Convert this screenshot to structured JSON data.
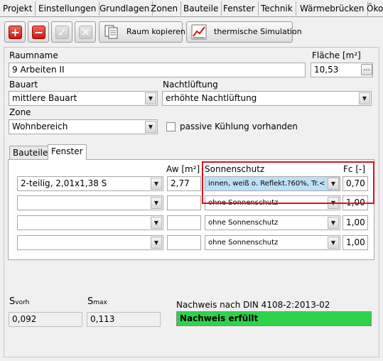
{
  "menu": [
    "Projekt",
    "Einstellungen",
    "Grundlagen",
    "Zonen",
    "Bauteile",
    "Fenster",
    "Technik",
    "Wärmebrücken",
    "Öko"
  ],
  "toolbar": {
    "raum_kopieren": "Raum kopieren",
    "thermische_simulation": "thermische Simulation"
  },
  "raum": {
    "raumname_label": "Raumname",
    "raumname_value": "9 Arbeiten II",
    "flaeche_label": "Fläche [m²]",
    "flaeche_value": "10,53",
    "dots": "..."
  },
  "bauart": {
    "label": "Bauart",
    "value": "mittlere Bauart"
  },
  "nachtlueftung": {
    "label": "Nachtlüftung",
    "value": "erhöhte Nachtlüftung"
  },
  "zone": {
    "label": "Zone",
    "value": "Wohnbereich"
  },
  "passive_kuehlung": {
    "label": "passive Kühlung vorhanden",
    "checked": false
  },
  "tabs": [
    "Bauteile",
    "Fenster"
  ],
  "fenster": {
    "headers": {
      "aw": "Aw [m²]",
      "sonnenschutz": "Sonnenschutz",
      "fc": "Fc [-]"
    },
    "rows": [
      {
        "fenster": "2-teilig, 2,01x1,38 S",
        "aw": "2,77",
        "sonnenschutz": "innen, weiß o. Reflekt.?60%, Tr.<=",
        "fc": "0,70"
      },
      {
        "fenster": "",
        "aw": "",
        "sonnenschutz": "ohne Sonnenschutz",
        "fc": "1,00"
      },
      {
        "fenster": "",
        "aw": "",
        "sonnenschutz": "ohne Sonnenschutz",
        "fc": "1,00"
      },
      {
        "fenster": "",
        "aw": "",
        "sonnenschutz": "ohne Sonnenschutz",
        "fc": "1,00"
      }
    ]
  },
  "nachweis": {
    "svorh_main": "S",
    "svorh_sub": "vorh",
    "svorh_value": "0,092",
    "smax_main": "S",
    "smax_sub": "max",
    "smax_value": "0,113",
    "label": "Nachweis nach DIN 4108-2:2013-02",
    "result": "Nachweis erfüllt",
    "result_color": "#2fd34b"
  },
  "icons": [
    "plus-icon",
    "minus-icon",
    "check-icon",
    "cross-icon",
    "copy-icon",
    "chart-icon",
    "chevron-down-icon"
  ]
}
